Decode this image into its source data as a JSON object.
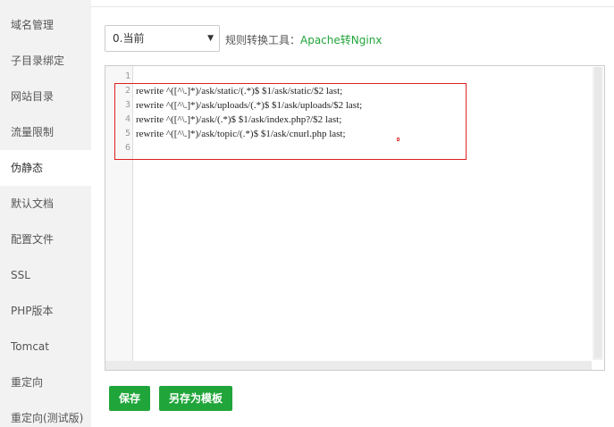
{
  "sidebar": {
    "items": [
      {
        "label": "域名管理"
      },
      {
        "label": "子目录绑定"
      },
      {
        "label": "网站目录"
      },
      {
        "label": "流量限制"
      },
      {
        "label": "伪静态"
      },
      {
        "label": "默认文档"
      },
      {
        "label": "配置文件"
      },
      {
        "label": "SSL"
      },
      {
        "label": "PHP版本"
      },
      {
        "label": "Tomcat"
      },
      {
        "label": "重定向"
      },
      {
        "label": "重定向(测试版)"
      }
    ],
    "active": "伪静态"
  },
  "rule_select": {
    "value": "0.当前"
  },
  "tool": {
    "label": "规则转换工具：",
    "link": "Apache转Nginx"
  },
  "editor": {
    "lines": [
      {
        "no": "1",
        "text": ""
      },
      {
        "no": "2",
        "text": "rewrite ^([^\\.]*)/ask/static/(.*)$ $1/ask/static/$2 last;"
      },
      {
        "no": "3",
        "text": "rewrite ^([^\\.]*)/ask/uploads/(.*)$ $1/ask/uploads/$2 last;"
      },
      {
        "no": "4",
        "text": "rewrite ^([^\\.]*)/ask/(.*)$ $1/ask/index.php?/$2 last;"
      },
      {
        "no": "5",
        "text": "rewrite ^([^\\.]*)/ask/topic/(.*)$ $1/ask/cnurl.php last;"
      },
      {
        "no": "6",
        "text": ""
      }
    ]
  },
  "buttons": {
    "save": "保存",
    "save_as_template": "另存为模板"
  },
  "colors": {
    "accent": "#20a53a",
    "highlight": "#e02020"
  }
}
